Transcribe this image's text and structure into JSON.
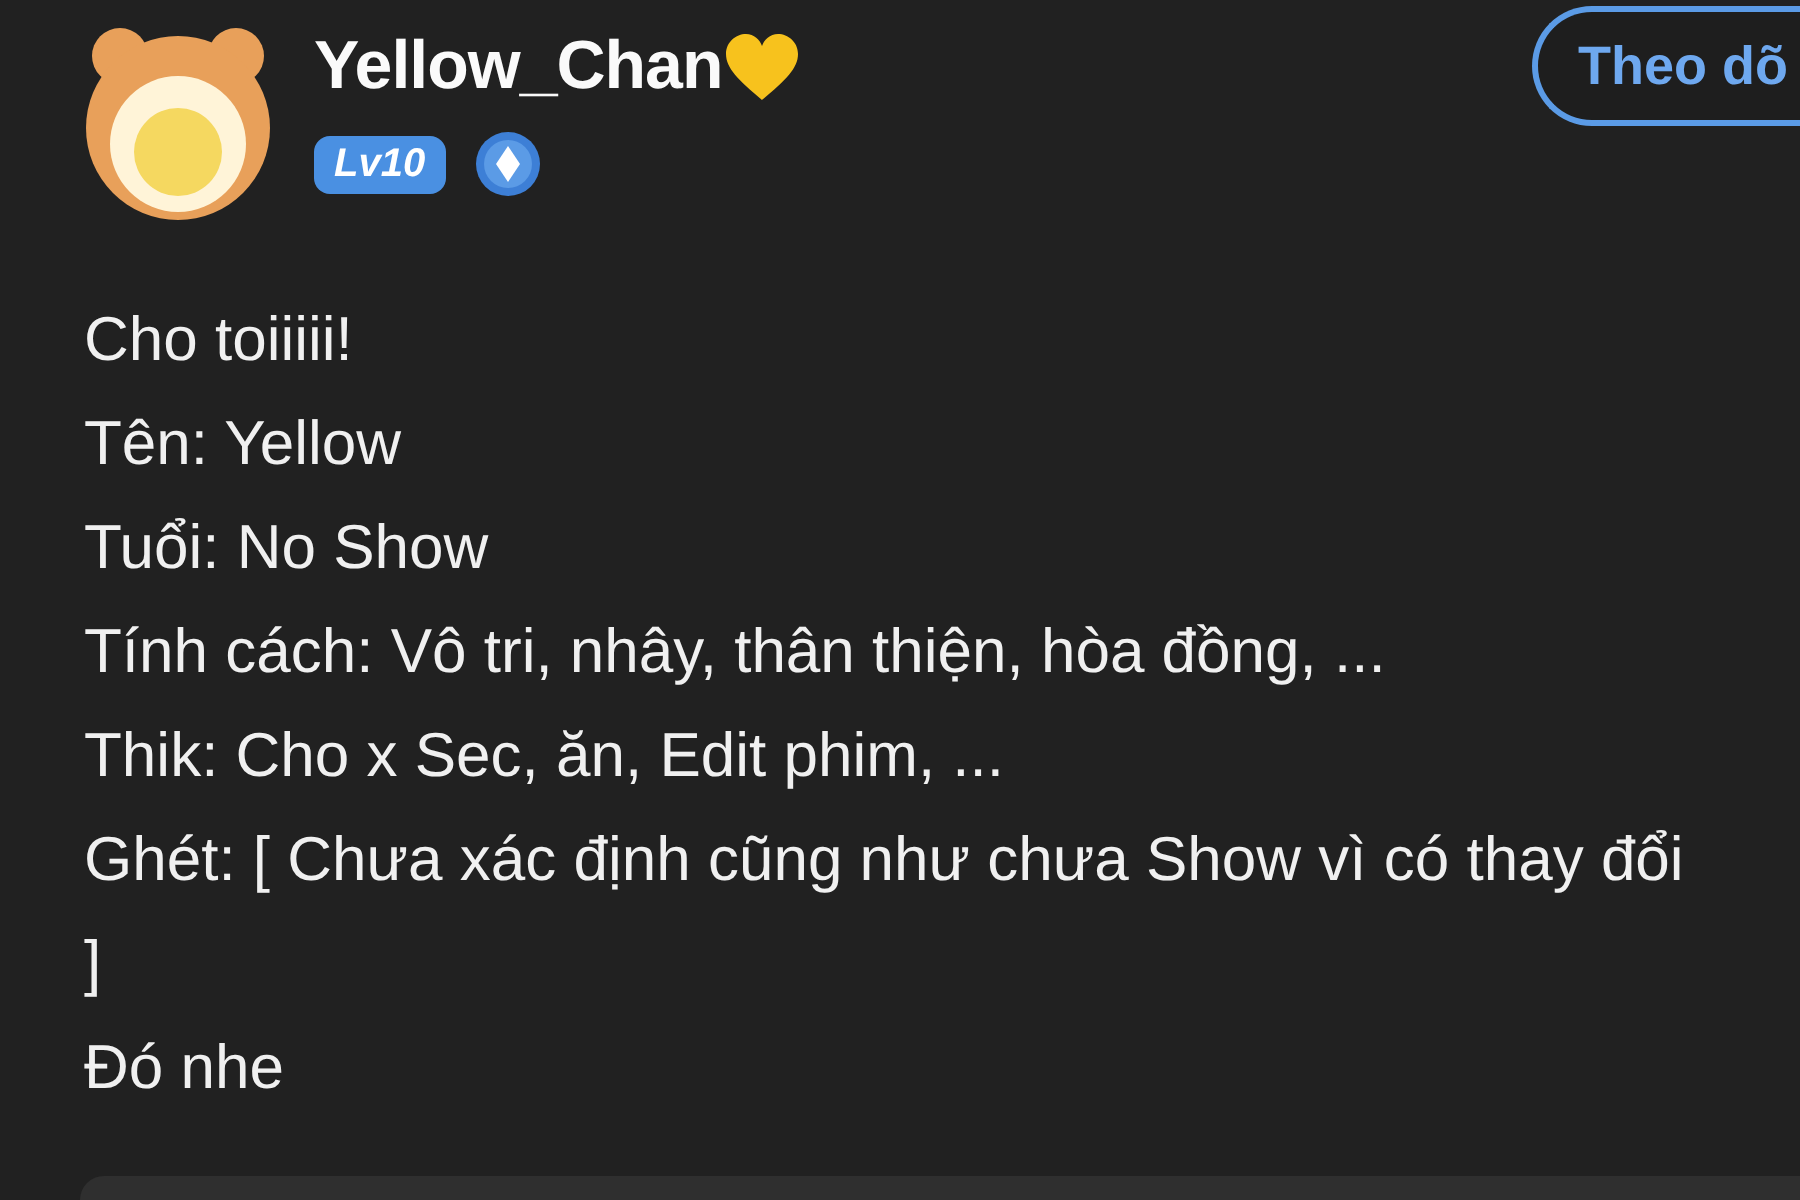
{
  "profile": {
    "username": "Yellow_Chan",
    "level_badge": "Lv10",
    "follow_button": "Theo dõ"
  },
  "bio_lines": [
    "Cho toiiiii!",
    "Tên: Yellow",
    "Tuổi: No Show",
    "Tính cách: Vô tri, nhây, thân thiện, hòa đồng, ...",
    "Thik: Cho x Sec, ăn, Edit phim, ...",
    "Ghét: [ Chưa xác định cũng như chưa Show vì có thay đổi ]",
    "Đó nhe"
  ]
}
